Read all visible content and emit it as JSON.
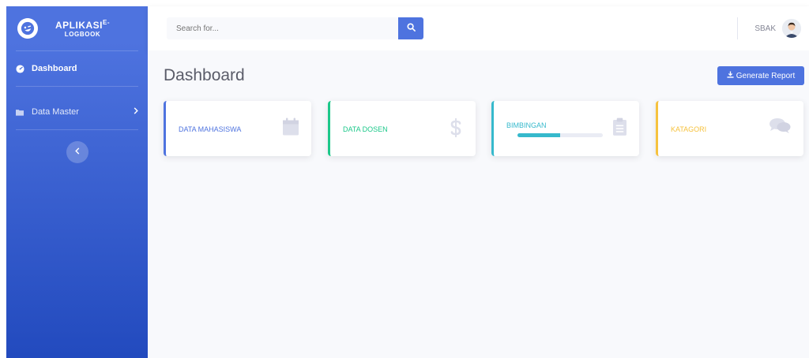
{
  "brand": {
    "title": "APLIKASI",
    "title_sup": "E-",
    "subtitle": "LOGBOOK",
    "icon": "laugh-wink-icon"
  },
  "sidebar": {
    "items": [
      {
        "label": "Dashboard",
        "icon": "tachometer-icon",
        "active": true
      },
      {
        "label": "Data Master",
        "icon": "folder-icon",
        "chevron": "chevron-right-icon"
      }
    ],
    "toggle_icon": "chevron-left-icon"
  },
  "search": {
    "placeholder": "Search for...",
    "icon": "search-icon"
  },
  "user": {
    "name": "SBAK",
    "avatar": "user-avatar"
  },
  "main": {
    "title": "Dashboard",
    "report_button": {
      "label": "Generate Report",
      "icon": "download-icon"
    }
  },
  "cards": [
    {
      "label": "DATA MAHASISWA",
      "color": "#4e73df",
      "icon": "calendar-icon"
    },
    {
      "label": "DATA DOSEN",
      "color": "#1cc88a",
      "icon": "dollar-icon"
    },
    {
      "label": "BIMBINGAN",
      "color": "#36b9cc",
      "icon": "clipboard-icon",
      "progress": 0.5
    },
    {
      "label": "KATAGORI",
      "color": "#f6c23e",
      "icon": "comments-icon"
    }
  ],
  "colors": {
    "primary": "#4e73df",
    "success": "#1cc88a",
    "info": "#36b9cc",
    "warning": "#f6c23e"
  }
}
